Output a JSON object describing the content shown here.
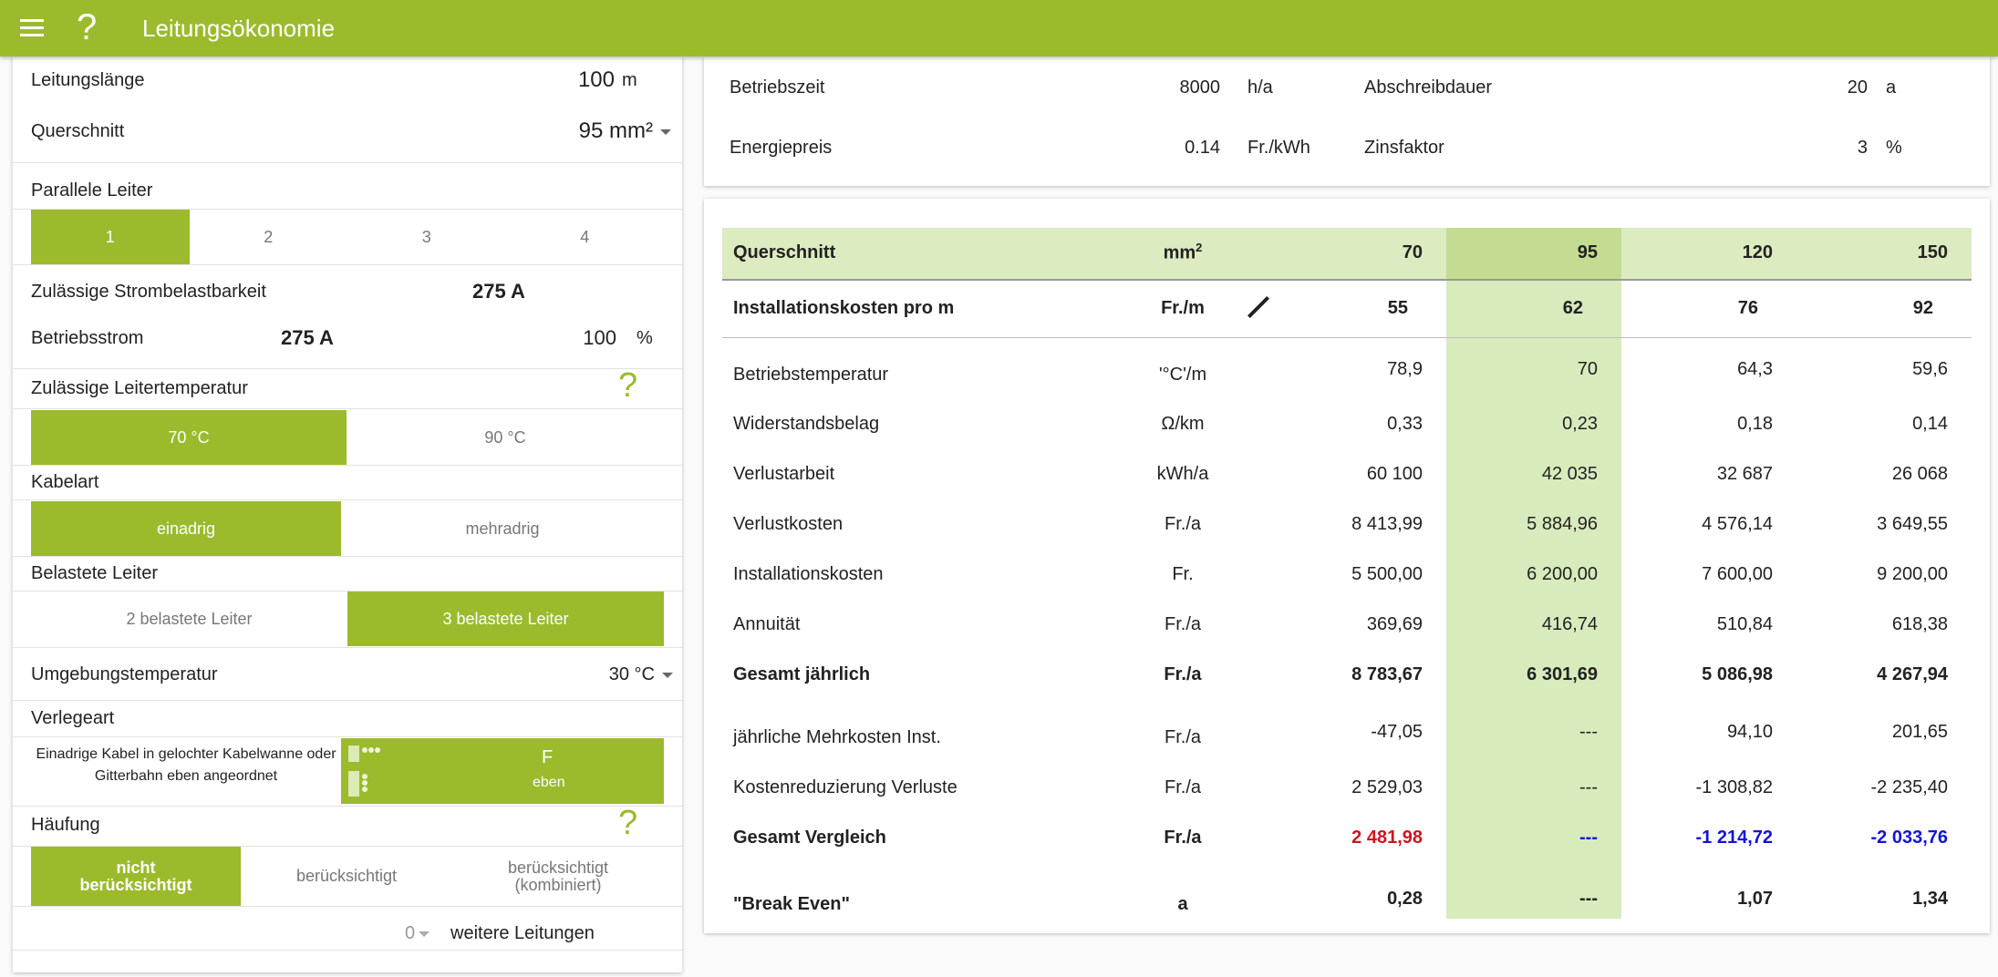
{
  "app": {
    "title": "Leitungsökonomie"
  },
  "left": {
    "length": {
      "label": "Leitungslänge",
      "value": "100",
      "unit": "m"
    },
    "section": {
      "label": "Querschnitt",
      "value": "95 mm²"
    },
    "parallel": {
      "label": "Parallele Leiter",
      "options": [
        "1",
        "2",
        "3",
        "4"
      ],
      "selected": "1"
    },
    "ampacity": {
      "label": "Zulässige Strombelastbarkeit",
      "value": "275 A"
    },
    "operating_current": {
      "label": "Betriebsstrom",
      "value": "275 A",
      "percent": "100",
      "percent_unit": "%"
    },
    "conductor_temp": {
      "label": "Zulässige Leitertemperatur",
      "help": "?",
      "options": [
        "70 °C",
        "90 °C"
      ],
      "selected": "70 °C"
    },
    "cable_type": {
      "label": "Kabelart",
      "options": [
        "einadrig",
        "mehradrig"
      ],
      "selected": "einadrig"
    },
    "loaded": {
      "label": "Belastete Leiter",
      "options": [
        "2 belastete Leiter",
        "3 belastete Leiter"
      ],
      "selected": "3 belastete Leiter"
    },
    "ambient": {
      "label": "Umgebungstemperatur",
      "value": "30 °C"
    },
    "laying": {
      "label": "Verlegeart",
      "description_line1": "Einadrige Kabel in gelochter Kabelwanne oder",
      "description_line2": "Gitterbahn eben angeordnet",
      "code": "F",
      "subcode": "eben"
    },
    "grouping": {
      "label": "Häufung",
      "help": "?",
      "options": [
        {
          "line1": "nicht",
          "line2": "berücksichtigt"
        },
        {
          "line1": "berücksichtigt",
          "line2": ""
        },
        {
          "line1": "berücksichtigt",
          "line2": "(kombiniert)"
        }
      ],
      "selected": 0,
      "more_count": "0",
      "more_label": "weitere Leitungen"
    }
  },
  "params": {
    "operating_time": {
      "label": "Betriebszeit",
      "value": "8000",
      "unit": "h/a"
    },
    "energy_price": {
      "label": "Energiepreis",
      "value": "0.14",
      "unit": "Fr./kWh"
    },
    "depreciation": {
      "label": "Abschreibdauer",
      "value": "20",
      "unit": "a"
    },
    "interest": {
      "label": "Zinsfaktor",
      "value": "3",
      "unit": "%"
    }
  },
  "table": {
    "header": {
      "label": "Querschnitt",
      "unit": "mm",
      "unit_sup": "2",
      "columns": [
        "70",
        "95",
        "120",
        "150"
      ]
    },
    "selected_column": 1,
    "install_per_m": {
      "label": "Installationskosten pro m",
      "unit": "Fr./m",
      "values": [
        "55",
        "62",
        "76",
        "92"
      ]
    },
    "rows": [
      {
        "label": "Betriebstemperatur",
        "unit": "'°C'/m",
        "values": [
          "78,9",
          "70",
          "64,3",
          "59,6"
        ],
        "bold": false
      },
      {
        "label": "Widerstandsbelag",
        "unit": "Ω/km",
        "values": [
          "0,33",
          "0,23",
          "0,18",
          "0,14"
        ],
        "bold": false
      },
      {
        "label": "Verlustarbeit",
        "unit": "kWh/a",
        "values": [
          "60 100",
          "42 035",
          "32 687",
          "26 068"
        ],
        "bold": false
      },
      {
        "label": "Verlustkosten",
        "unit": "Fr./a",
        "values": [
          "8 413,99",
          "5 884,96",
          "4 576,14",
          "3 649,55"
        ],
        "bold": false
      },
      {
        "label": "Installationskosten",
        "unit": "Fr.",
        "values": [
          "5 500,00",
          "6 200,00",
          "7 600,00",
          "9 200,00"
        ],
        "bold": false
      },
      {
        "label": "Annuität",
        "unit": "Fr./a",
        "values": [
          "369,69",
          "416,74",
          "510,84",
          "618,38"
        ],
        "bold": false
      },
      {
        "label": "Gesamt jährlich",
        "unit": "Fr./a",
        "values": [
          "8 783,67",
          "6 301,69",
          "5 086,98",
          "4 267,94"
        ],
        "bold": true
      },
      {
        "label": "jährliche Mehrkosten Inst.",
        "unit": "Fr./a",
        "values": [
          "-47,05",
          "---",
          "94,10",
          "201,65"
        ],
        "bold": false
      },
      {
        "label": "Kostenreduzierung Verluste",
        "unit": "Fr./a",
        "values": [
          "2 529,03",
          "---",
          "-1 308,82",
          "-2 235,40"
        ],
        "bold": false
      },
      {
        "label": "Gesamt Vergleich",
        "unit": "Fr./a",
        "values": [
          "2 481,98",
          "---",
          "-1 214,72",
          "-2 033,76"
        ],
        "bold": true
      },
      {
        "label": "\"Break Even\"",
        "unit": "a",
        "values": [
          "0,28",
          "---",
          "1,07",
          "1,34"
        ],
        "bold": true
      }
    ],
    "colors": {
      "positive": "#d0131f",
      "negative": "#1313d6",
      "accent": "#9bbb2d"
    }
  }
}
